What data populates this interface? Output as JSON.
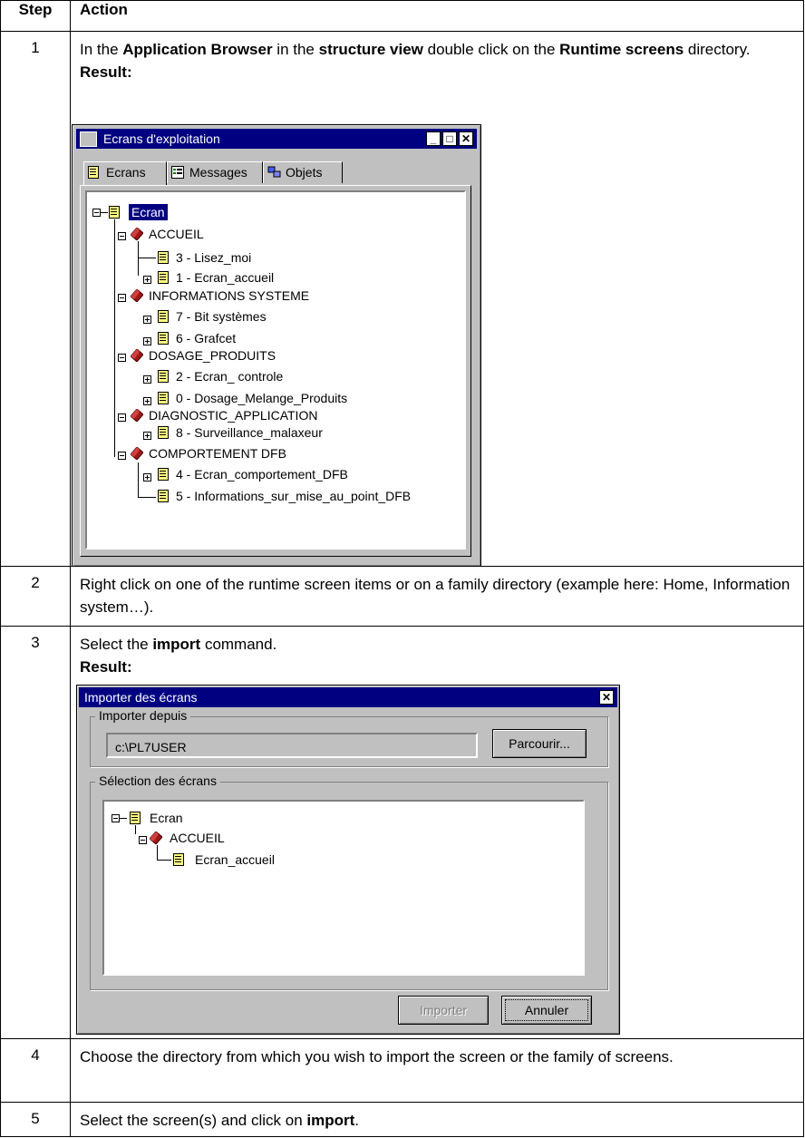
{
  "table": {
    "headers": {
      "step": "Step",
      "action": "Action"
    },
    "rows": [
      {
        "step": "1",
        "text_parts": [
          "In the ",
          "Application Browser",
          " in the ",
          "structure view",
          " double click on the ",
          "Runtime screens",
          " directory."
        ],
        "result_label": "Result:"
      },
      {
        "step": "2",
        "text": "Right click on one of the runtime screen items or on a family directory (example here: Home, Information system…)."
      },
      {
        "step": "3",
        "text_parts": [
          "Select the ",
          "import",
          " command."
        ],
        "result_label": "Result:"
      },
      {
        "step": "4",
        "text": "Choose the directory from which you wish to import the screen or the family of screens."
      },
      {
        "step": "5",
        "text_parts": [
          "Select the screen(s) and click on ",
          "import",
          "."
        ]
      }
    ]
  },
  "window1": {
    "title": "Ecrans d'exploitation",
    "tabs": [
      "Ecrans",
      "Messages",
      "Objets"
    ],
    "tree": {
      "root": "Ecran",
      "families": [
        {
          "label": "ACCUEIL",
          "items": [
            "3 - Lisez_moi",
            "1 - Ecran_accueil"
          ]
        },
        {
          "label": "INFORMATIONS SYSTEME",
          "items": [
            "7 - Bit systèmes",
            "6 - Grafcet"
          ]
        },
        {
          "label": "DOSAGE_PRODUITS",
          "items": [
            "2 - Ecran_ controle",
            "0 - Dosage_Melange_Produits"
          ]
        },
        {
          "label": "DIAGNOSTIC_APPLICATION",
          "items": [
            "8 - Surveillance_malaxeur"
          ]
        },
        {
          "label": "COMPORTEMENT DFB",
          "items": [
            "4 - Ecran_comportement_DFB",
            "5 - Informations_sur_mise_au_point_DFB"
          ]
        }
      ]
    }
  },
  "window2": {
    "title": "Importer des écrans",
    "import_from_label": "Importer depuis",
    "path_value": "c:\\PL7USER",
    "browse_label": "Parcourir...",
    "selection_label": "Sélection des écrans",
    "tree": {
      "root": "Ecran",
      "family": "ACCUEIL",
      "item": "Ecran_accueil"
    },
    "import_button": "Importer",
    "cancel_button": "Annuler"
  },
  "colors": {
    "titlebar": "#000080",
    "dialog": "#c0c0c0",
    "book": "#8b1a1a",
    "selection": "#000080"
  }
}
